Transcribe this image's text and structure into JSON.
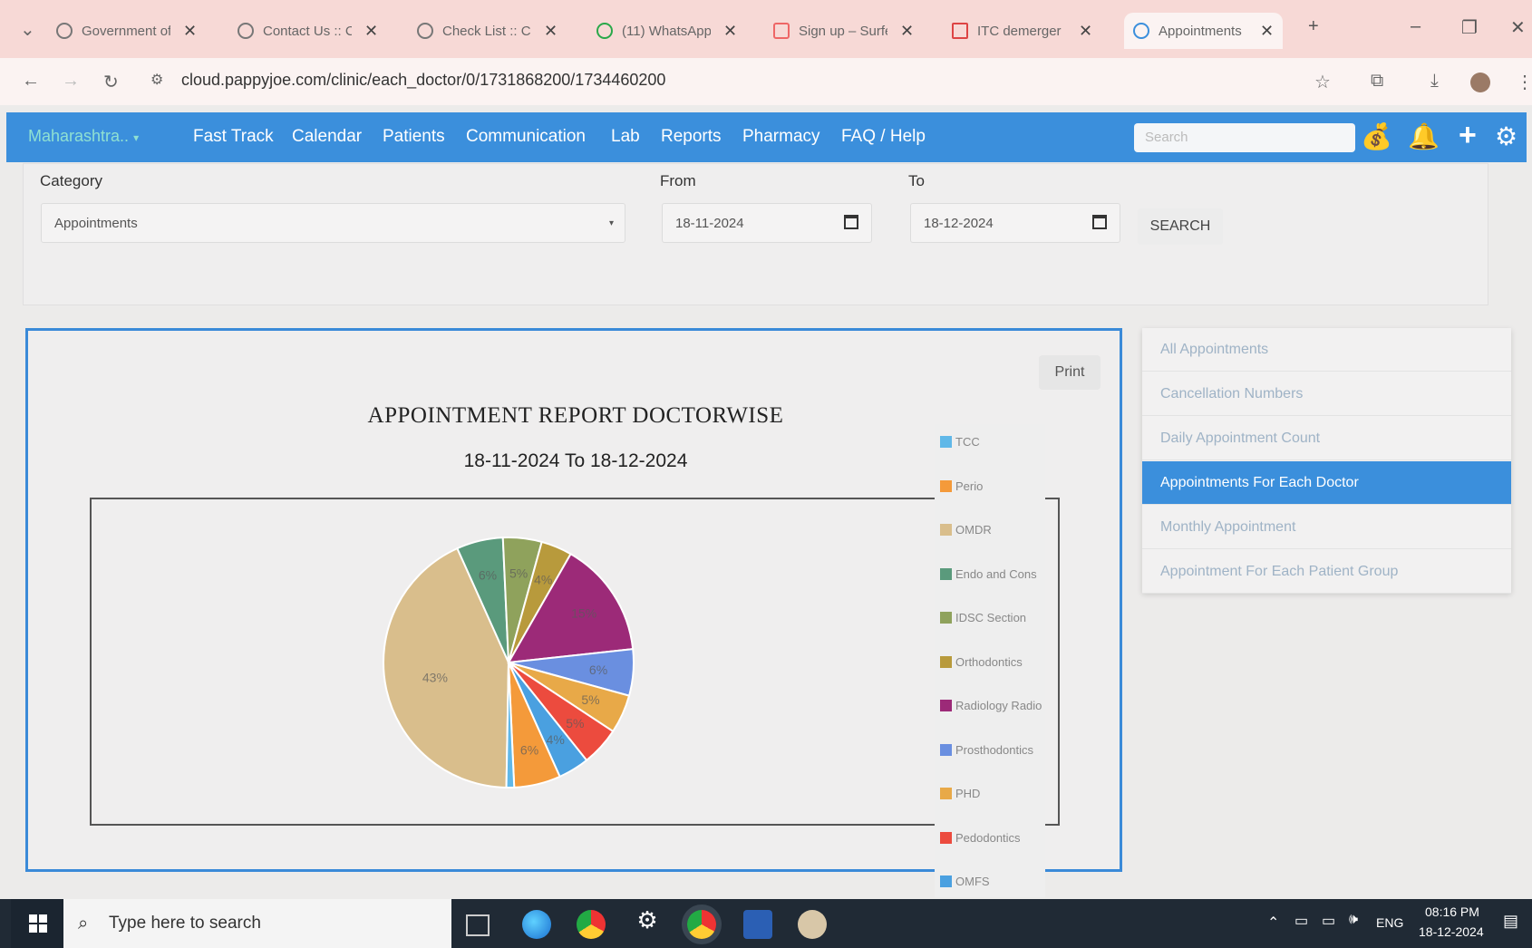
{
  "browser": {
    "tabs": [
      {
        "title": "Government of"
      },
      {
        "title": "Contact Us :: Co"
      },
      {
        "title": "Check List :: Co"
      },
      {
        "title": "(11) WhatsApp"
      },
      {
        "title": "Sign up – Surfer"
      },
      {
        "title": "ITC demerger"
      },
      {
        "title": "Appointments"
      }
    ],
    "url": "cloud.pappyjoe.com/clinic/each_doctor/0/1731868200/1734460200"
  },
  "nav": {
    "brand": "Maharashtra..",
    "items": [
      "Fast Track",
      "Calendar",
      "Patients",
      "Communication",
      "Lab",
      "Reports",
      "Pharmacy",
      "FAQ / Help"
    ],
    "search_placeholder": "Search"
  },
  "filter": {
    "category_label": "Category",
    "category_value": "Appointments",
    "from_label": "From",
    "from_value": "18-11-2024",
    "to_label": "To",
    "to_value": "18-12-2024",
    "search_button": "SEARCH"
  },
  "report": {
    "print_label": "Print"
  },
  "chart_data": {
    "type": "pie",
    "title": "APPOINTMENT REPORT DOCTORWISE",
    "subtitle": "18-11-2024 To 18-12-2024",
    "legend_position": "right",
    "slices": [
      {
        "name": "OMDR",
        "value": 43,
        "label": "43%",
        "color": "#d9be8c"
      },
      {
        "name": "Endo and Cons",
        "value": 6,
        "label": "6%",
        "color": "#5a9a7c"
      },
      {
        "name": "IDSC Section",
        "value": 5,
        "label": "5%",
        "color": "#8fa25c"
      },
      {
        "name": "Orthodontics",
        "value": 4,
        "label": "4%",
        "color": "#b89a3c"
      },
      {
        "name": "Radiology Radio",
        "value": 15,
        "label": "15%",
        "color": "#9c2a78"
      },
      {
        "name": "Prosthodontics",
        "value": 6,
        "label": "6%",
        "color": "#6a8fe0"
      },
      {
        "name": "PHD",
        "value": 5,
        "label": "5%",
        "color": "#e8a948"
      },
      {
        "name": "Pedodontics",
        "value": 5,
        "label": "5%",
        "color": "#ec4b3e"
      },
      {
        "name": "OMFS",
        "value": 4,
        "label": "4%",
        "color": "#4aa0e0"
      },
      {
        "name": "Perio",
        "value": 6,
        "label": "6%",
        "color": "#f49a3a"
      },
      {
        "name": "TCC",
        "value": 1,
        "label": "",
        "color": "#60b8e8"
      }
    ],
    "legend": [
      "TCC",
      "Perio",
      "OMDR",
      "Endo and Cons",
      "IDSC Section",
      "Orthodontics",
      "Radiology Radio",
      "Prosthodontics",
      "PHD",
      "Pedodontics",
      "OMFS"
    ]
  },
  "sidemenu": {
    "items": [
      {
        "label": "All Appointments"
      },
      {
        "label": "Cancellation Numbers"
      },
      {
        "label": "Daily Appointment Count"
      },
      {
        "label": "Appointments For Each Doctor"
      },
      {
        "label": "Monthly Appointment"
      },
      {
        "label": "Appointment For Each Patient Group"
      }
    ],
    "active_index": 3
  },
  "taskbar": {
    "search_placeholder": "Type here to search",
    "language": "ENG",
    "time": "08:16 PM",
    "date": "18-12-2024"
  }
}
